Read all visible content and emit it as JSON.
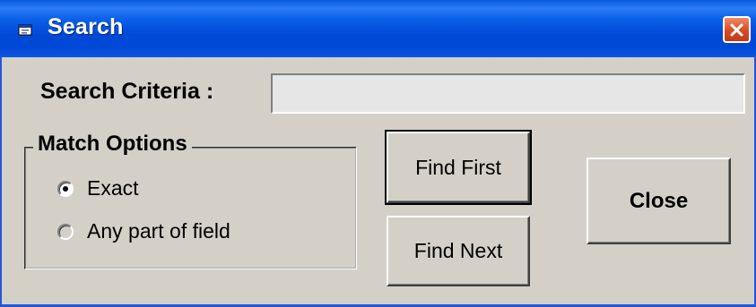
{
  "window": {
    "title": "Search"
  },
  "search": {
    "label": "Search Criteria :",
    "value": ""
  },
  "match_options": {
    "title": "Match Options",
    "options": [
      {
        "label": "Exact",
        "selected": true
      },
      {
        "label": "Any part of field",
        "selected": false
      }
    ]
  },
  "buttons": {
    "find_first": "Find First",
    "find_next": "Find Next",
    "close": "Close"
  },
  "icons": {
    "app": "search-app-icon",
    "close": "close-icon"
  },
  "colors": {
    "titlebar": "#0049d6",
    "face": "#d4d0c8",
    "close_button": "#d94a22"
  }
}
